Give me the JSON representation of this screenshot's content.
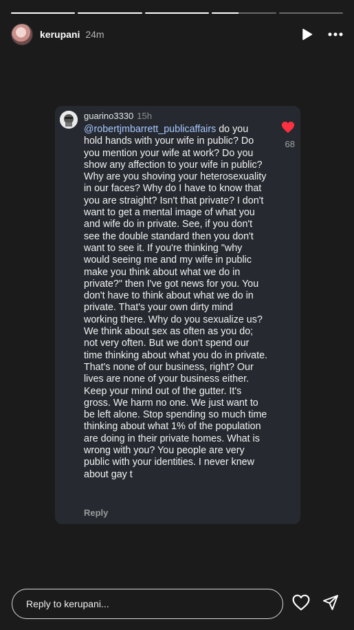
{
  "header": {
    "username": "kerupani",
    "time": "24m"
  },
  "progress": [
    1,
    1,
    1,
    0.42,
    0
  ],
  "comment": {
    "username": "guarino3330",
    "time": "15h",
    "mention": "@robertjmbarrett_publicaffairs",
    "text": " do you hold hands with your wife in public? Do you mention your wife at work? Do you show any affection to your wife in public? Why are you shoving your heterosexuality in our faces? Why do I have to know that you are straight? Isn't that private? I don't want to get a mental image of what you and wife do in private. See, if you don't see the double standard then you don't want to see it. If you're thinking \"why would seeing me and my wife in public make you think about what we do in private?\" then I've got news for you. You don't have to think about what we do in private. That's your own dirty mind working there. Why do you sexualize us? We think about sex as often as you do; not very often. But we don't spend our time thinking about what you do in private. That's none of our business, right? Our lives are none of your business either. Keep your mind out of the gutter. It's gross. We harm no one. We just want to be left alone. Stop spending so much time thinking about what 1% of the population are doing in their private homes. What is wrong with you? You people are very public with your identities. I never knew about gay t",
    "like_count": "68",
    "reply_label": "Reply",
    "heart_color": "#ff3040"
  },
  "footer": {
    "reply_placeholder": "Reply to kerupani..."
  },
  "icons": {
    "play": "play-icon",
    "more": "more-icon",
    "heart": "heart-outline-icon",
    "send": "send-icon"
  }
}
